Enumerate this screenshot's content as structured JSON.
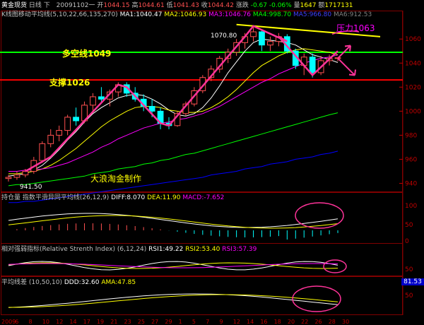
{
  "header": {
    "symbol": "黄金现货",
    "period": "日线",
    "variant": "下",
    "date": "20091102",
    "weekday": "一",
    "open_label": "开",
    "open": "1044.15",
    "high_label": "高",
    "high": "1044.61",
    "low_label": "低",
    "low": "1041.43",
    "close_label": "收",
    "close": "1044.42",
    "change_label": "涨跌",
    "change": "-0.67",
    "change_pct": "-0.06%",
    "volume_label": "量",
    "volume": "1647",
    "amount_label": "额",
    "amount": "1717131"
  },
  "ma_legend": {
    "title": "K线图",
    "name": "移动平均线",
    "params": "(5,10,22,66,135,270)",
    "items": [
      {
        "label": "MA1:1040.47",
        "color": "#ffffff"
      },
      {
        "label": "MA2:1046.93",
        "color": "#ffff00"
      },
      {
        "label": "MA3:1046.76",
        "color": "#ff00ff"
      },
      {
        "label": "MA4:998.70",
        "color": "#00ff00"
      },
      {
        "label": "MA5:966.80",
        "color": "#0000ff"
      },
      {
        "label": "MA6:912.53",
        "color": "#808080"
      }
    ]
  },
  "annotations": {
    "resistance_label": "压力1063",
    "long_short_label": "多空线1049",
    "support_label": "支撑1026",
    "author_label": "大浪淘金制作",
    "peak_label": "1070.80",
    "trough_label": "941.50"
  },
  "panels": {
    "macd": {
      "label": "持仓量",
      "name": "指数平滑异同平均线",
      "params": "(26,12,9)",
      "diff": "DIFF:8.070",
      "dea": "DEA:11.90",
      "macd": "MACD:-7.652",
      "ticks": [
        "100",
        "50",
        "0"
      ]
    },
    "rsi": {
      "label": "相对强弱指标(Relative Strenth Index)",
      "params": "(6,12,24)",
      "rsi1": "RSI1:49.22",
      "rsi2": "RSI2:53.40",
      "rsi3": "RSI3:57.39",
      "ticks": [
        "50"
      ]
    },
    "dma": {
      "label": "平均线差",
      "params": "(10,50,10)",
      "ddd": "DDD:32.60",
      "ama": "AMA:47.85",
      "ticks": [
        "50"
      ],
      "badge": "81.53"
    }
  },
  "date_axis": {
    "labels": [
      "2009",
      "6",
      "8",
      "10",
      "12",
      "14",
      "17",
      "19",
      "21",
      "23",
      "25",
      "27",
      "29",
      "1",
      "5",
      "7",
      "9",
      "12",
      "14",
      "16",
      "18",
      "20",
      "22",
      "26",
      "28",
      "30"
    ]
  },
  "chart_data": {
    "type": "candlestick",
    "title": "",
    "y_ticks": [
      940,
      960,
      980,
      1000,
      1020,
      1040,
      1060
    ],
    "ylim": [
      935,
      1076
    ],
    "horizontal_lines": [
      {
        "label": "多空线1049",
        "value": 1049,
        "color": "#00ff00"
      },
      {
        "label": "支撑1026",
        "value": 1026,
        "color": "#ff0000"
      },
      {
        "label": "压力1063",
        "value": 1063,
        "color": "#ffff00"
      }
    ],
    "candles": [
      {
        "o": 944,
        "h": 947,
        "l": 941.5,
        "c": 945
      },
      {
        "o": 945,
        "h": 950,
        "l": 943,
        "c": 947
      },
      {
        "o": 947,
        "h": 952,
        "l": 945,
        "c": 950
      },
      {
        "o": 950,
        "h": 962,
        "l": 948,
        "c": 959
      },
      {
        "o": 959,
        "h": 975,
        "l": 957,
        "c": 973
      },
      {
        "o": 973,
        "h": 985,
        "l": 970,
        "c": 980
      },
      {
        "o": 980,
        "h": 988,
        "l": 975,
        "c": 984
      },
      {
        "o": 984,
        "h": 997,
        "l": 980,
        "c": 995
      },
      {
        "o": 995,
        "h": 1003,
        "l": 988,
        "c": 992
      },
      {
        "o": 992,
        "h": 1008,
        "l": 990,
        "c": 1005
      },
      {
        "o": 1005,
        "h": 1015,
        "l": 1000,
        "c": 1012
      },
      {
        "o": 1012,
        "h": 1020,
        "l": 1008,
        "c": 1010
      },
      {
        "o": 1010,
        "h": 1018,
        "l": 1004,
        "c": 1016
      },
      {
        "o": 1016,
        "h": 1024,
        "l": 1012,
        "c": 1022
      },
      {
        "o": 1022,
        "h": 1024,
        "l": 1012,
        "c": 1015
      },
      {
        "o": 1015,
        "h": 1020,
        "l": 1008,
        "c": 1010
      },
      {
        "o": 1010,
        "h": 1014,
        "l": 1000,
        "c": 1004
      },
      {
        "o": 1004,
        "h": 1010,
        "l": 995,
        "c": 1000
      },
      {
        "o": 1000,
        "h": 1003,
        "l": 985,
        "c": 990
      },
      {
        "o": 990,
        "h": 995,
        "l": 985,
        "c": 988
      },
      {
        "o": 988,
        "h": 1000,
        "l": 987,
        "c": 998
      },
      {
        "o": 998,
        "h": 1008,
        "l": 996,
        "c": 1006
      },
      {
        "o": 1006,
        "h": 1020,
        "l": 1004,
        "c": 1017
      },
      {
        "o": 1017,
        "h": 1030,
        "l": 1015,
        "c": 1028
      },
      {
        "o": 1028,
        "h": 1038,
        "l": 1025,
        "c": 1035
      },
      {
        "o": 1035,
        "h": 1046,
        "l": 1032,
        "c": 1044
      },
      {
        "o": 1044,
        "h": 1052,
        "l": 1040,
        "c": 1049
      },
      {
        "o": 1049,
        "h": 1060,
        "l": 1046,
        "c": 1057
      },
      {
        "o": 1057,
        "h": 1065,
        "l": 1052,
        "c": 1062
      },
      {
        "o": 1062,
        "h": 1070.8,
        "l": 1058,
        "c": 1066
      },
      {
        "o": 1066,
        "h": 1068,
        "l": 1050,
        "c": 1055
      },
      {
        "o": 1055,
        "h": 1062,
        "l": 1050,
        "c": 1058
      },
      {
        "o": 1058,
        "h": 1065,
        "l": 1054,
        "c": 1062
      },
      {
        "o": 1062,
        "h": 1064,
        "l": 1048,
        "c": 1050
      },
      {
        "o": 1050,
        "h": 1052,
        "l": 1035,
        "c": 1038
      },
      {
        "o": 1038,
        "h": 1048,
        "l": 1030,
        "c": 1045
      },
      {
        "o": 1045,
        "h": 1048,
        "l": 1028,
        "c": 1032
      },
      {
        "o": 1032,
        "h": 1046,
        "l": 1030,
        "c": 1042
      },
      {
        "o": 1042,
        "h": 1047,
        "l": 1038,
        "c": 1044
      },
      {
        "o": 1044.15,
        "h": 1044.61,
        "l": 1041.43,
        "c": 1044.42
      }
    ],
    "ma_series": [
      {
        "name": "MA1",
        "color": "#ffffff",
        "values": [
          946,
          947,
          948,
          951,
          955,
          961,
          968,
          976,
          983,
          991,
          998,
          1003,
          1007,
          1011,
          1013,
          1014,
          1013,
          1010,
          1006,
          1001,
          997,
          996,
          998,
          1003,
          1011,
          1021,
          1032,
          1041,
          1050,
          1057,
          1060,
          1059,
          1058,
          1057,
          1055,
          1051,
          1047,
          1045,
          1043,
          1040.47
        ]
      },
      {
        "name": "MA2",
        "color": "#ffff00",
        "values": [
          948,
          948,
          949,
          950,
          952,
          955,
          959,
          964,
          969,
          975,
          981,
          987,
          992,
          996,
          1000,
          1003,
          1004,
          1004,
          1003,
          1001,
          1000,
          999,
          999,
          1000,
          1003,
          1007,
          1012,
          1018,
          1025,
          1032,
          1038,
          1042,
          1046,
          1049,
          1051,
          1052,
          1051,
          1050,
          1049,
          1046.93
        ]
      },
      {
        "name": "MA3",
        "color": "#ff00ff",
        "values": [
          950,
          950,
          951,
          951,
          952,
          953,
          955,
          957,
          960,
          963,
          966,
          970,
          973,
          977,
          980,
          983,
          986,
          988,
          990,
          991,
          993,
          994,
          996,
          998,
          1001,
          1004,
          1008,
          1012,
          1016,
          1020,
          1024,
          1027,
          1031,
          1034,
          1037,
          1040,
          1042,
          1044,
          1045,
          1046.76
        ]
      },
      {
        "name": "MA4",
        "color": "#00ff00",
        "values": [
          938,
          939,
          939,
          940,
          941,
          942,
          943,
          944,
          945,
          946,
          948,
          949,
          950,
          952,
          953,
          954,
          956,
          957,
          959,
          960,
          962,
          964,
          965,
          967,
          969,
          971,
          973,
          975,
          977,
          979,
          981,
          983,
          985,
          987,
          989,
          991,
          993,
          995,
          997,
          998.7
        ]
      },
      {
        "name": "MA5",
        "color": "#0000ff",
        "values": [
          924,
          924,
          925,
          925,
          926,
          927,
          928,
          929,
          930,
          931,
          932,
          933,
          934,
          935,
          936,
          937,
          938,
          939,
          940,
          941,
          942,
          943,
          944,
          945,
          947,
          948,
          949,
          950,
          952,
          953,
          954,
          956,
          957,
          958,
          960,
          961,
          962,
          964,
          965,
          966.8
        ]
      }
    ],
    "pattern_line": [
      950,
      962,
      1022,
      1020,
      990,
      988,
      1062,
      1070.8,
      1058,
      1062,
      1030,
      1050
    ]
  }
}
